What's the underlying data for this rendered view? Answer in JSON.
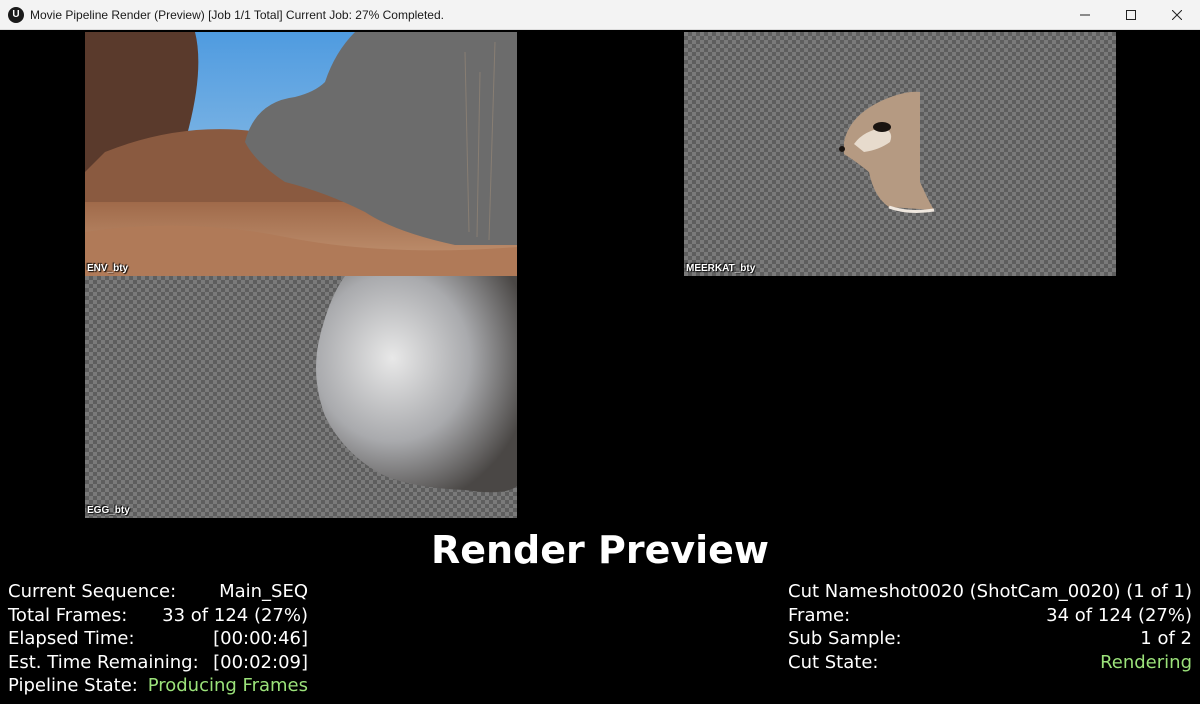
{
  "window": {
    "title": "Movie Pipeline Render (Preview) [Job 1/1 Total] Current Job: 27% Completed.",
    "logo_glyph": "U"
  },
  "panels": {
    "env": {
      "label": "ENV_bty"
    },
    "meerkat": {
      "label": "MEERKAT_bty"
    },
    "egg": {
      "label": "EGG_bty"
    }
  },
  "heading": "Render Preview",
  "left_stats": {
    "current_sequence": {
      "label": "Current Sequence:",
      "value": "Main_SEQ"
    },
    "total_frames": {
      "label": "Total Frames:",
      "value": "33 of 124 (27%)"
    },
    "elapsed_time": {
      "label": "Elapsed Time:",
      "value": "[00:00:46]"
    },
    "time_remaining": {
      "label": "Est. Time Remaining:",
      "value": "[00:02:09]"
    },
    "pipeline_state": {
      "label": "Pipeline State:",
      "value": "Producing Frames"
    }
  },
  "right_stats": {
    "cut_name": {
      "label": "Cut Name:",
      "value": "shot0020 (ShotCam_0020) (1 of 1)"
    },
    "frame": {
      "label": "Frame:",
      "value": "34 of 124 (27%)"
    },
    "sub_sample": {
      "label": "Sub Sample:",
      "value": "1 of 2"
    },
    "cut_state": {
      "label": "Cut State:",
      "value": "Rendering"
    }
  },
  "colors": {
    "status_green": "#9be27a",
    "background": "#000000",
    "titlebar": "#f3f3f3"
  },
  "icons": [
    "unreal-logo-icon",
    "minimize-icon",
    "maximize-icon",
    "close-icon"
  ]
}
